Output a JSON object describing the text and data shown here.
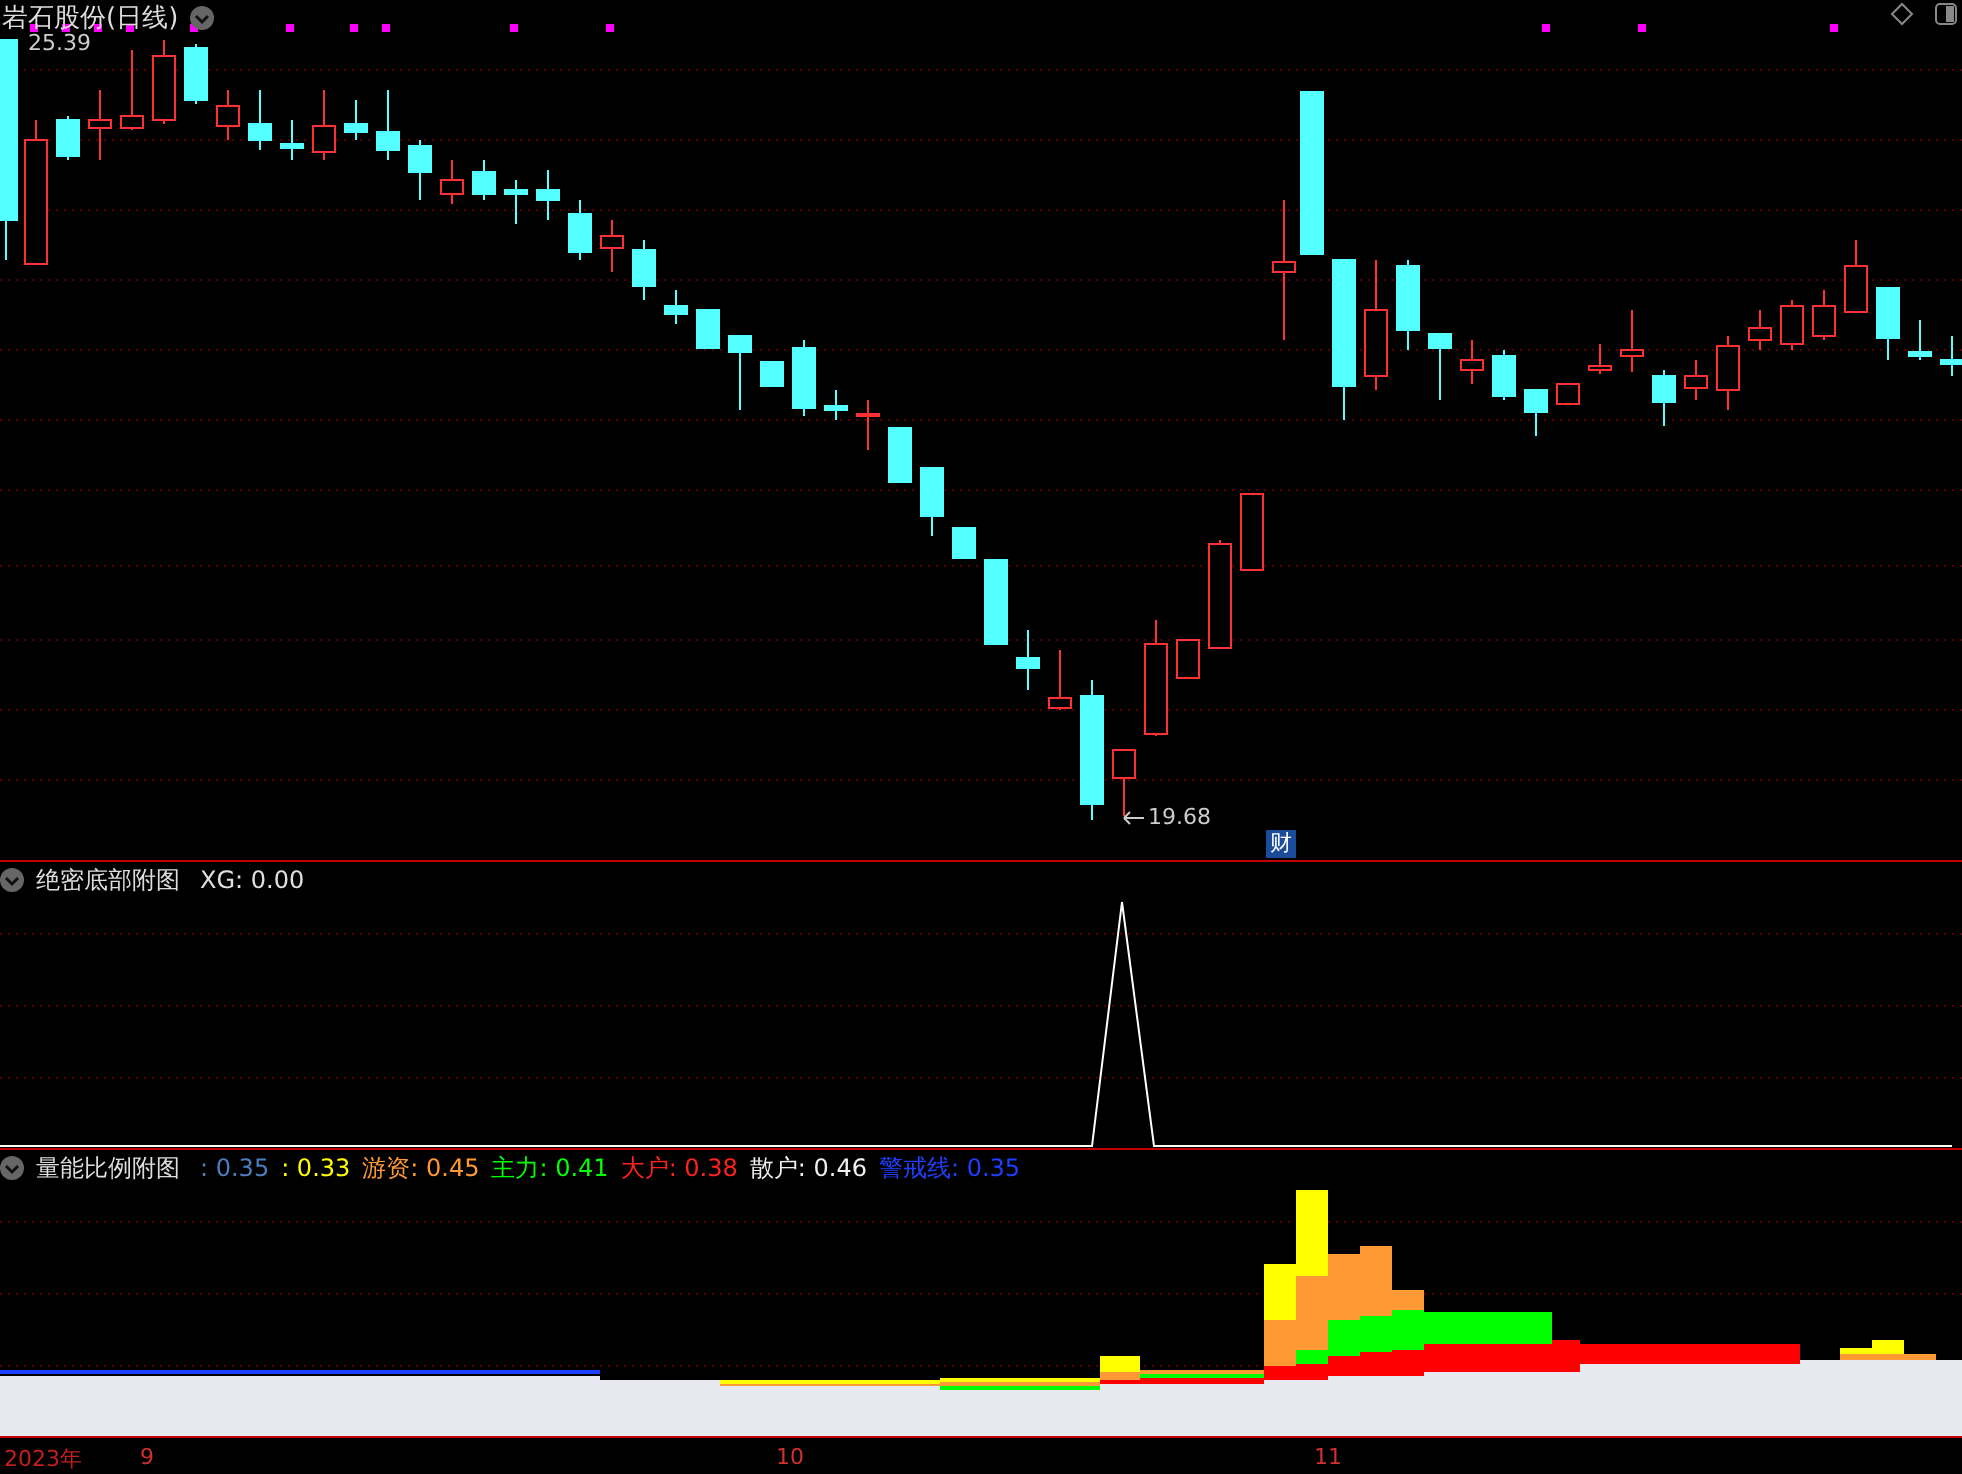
{
  "title": {
    "name": "岩石股份(日线)"
  },
  "main_chart": {
    "high_label": "25.39",
    "low_label": "19.68",
    "badge": "财"
  },
  "panels": [
    {
      "name": "绝密底部附图",
      "readouts": [
        {
          "text": "XG: 0.00",
          "color": "#e0e0e0"
        }
      ]
    },
    {
      "name": "量能比例附图",
      "readouts": [
        {
          "text": ": 0.35",
          "color": "#4a7fbf"
        },
        {
          "text": ": 0.33",
          "color": "#ffff00"
        },
        {
          "text": "游资: 0.45",
          "color": "#ff9933"
        },
        {
          "text": "主力: 0.41",
          "color": "#00ff00"
        },
        {
          "text": "大户: 0.38",
          "color": "#ff2020"
        },
        {
          "text": "散户: 0.46",
          "color": "#f0f0f0"
        },
        {
          "text": "警戒线: 0.35",
          "color": "#1f3fff"
        }
      ]
    }
  ],
  "axis": {
    "labels": [
      {
        "text": "2023年",
        "kind": "year"
      },
      {
        "text": "9",
        "kind": "month"
      },
      {
        "text": "10",
        "kind": "month"
      },
      {
        "text": "11",
        "kind": "month"
      }
    ]
  }
}
